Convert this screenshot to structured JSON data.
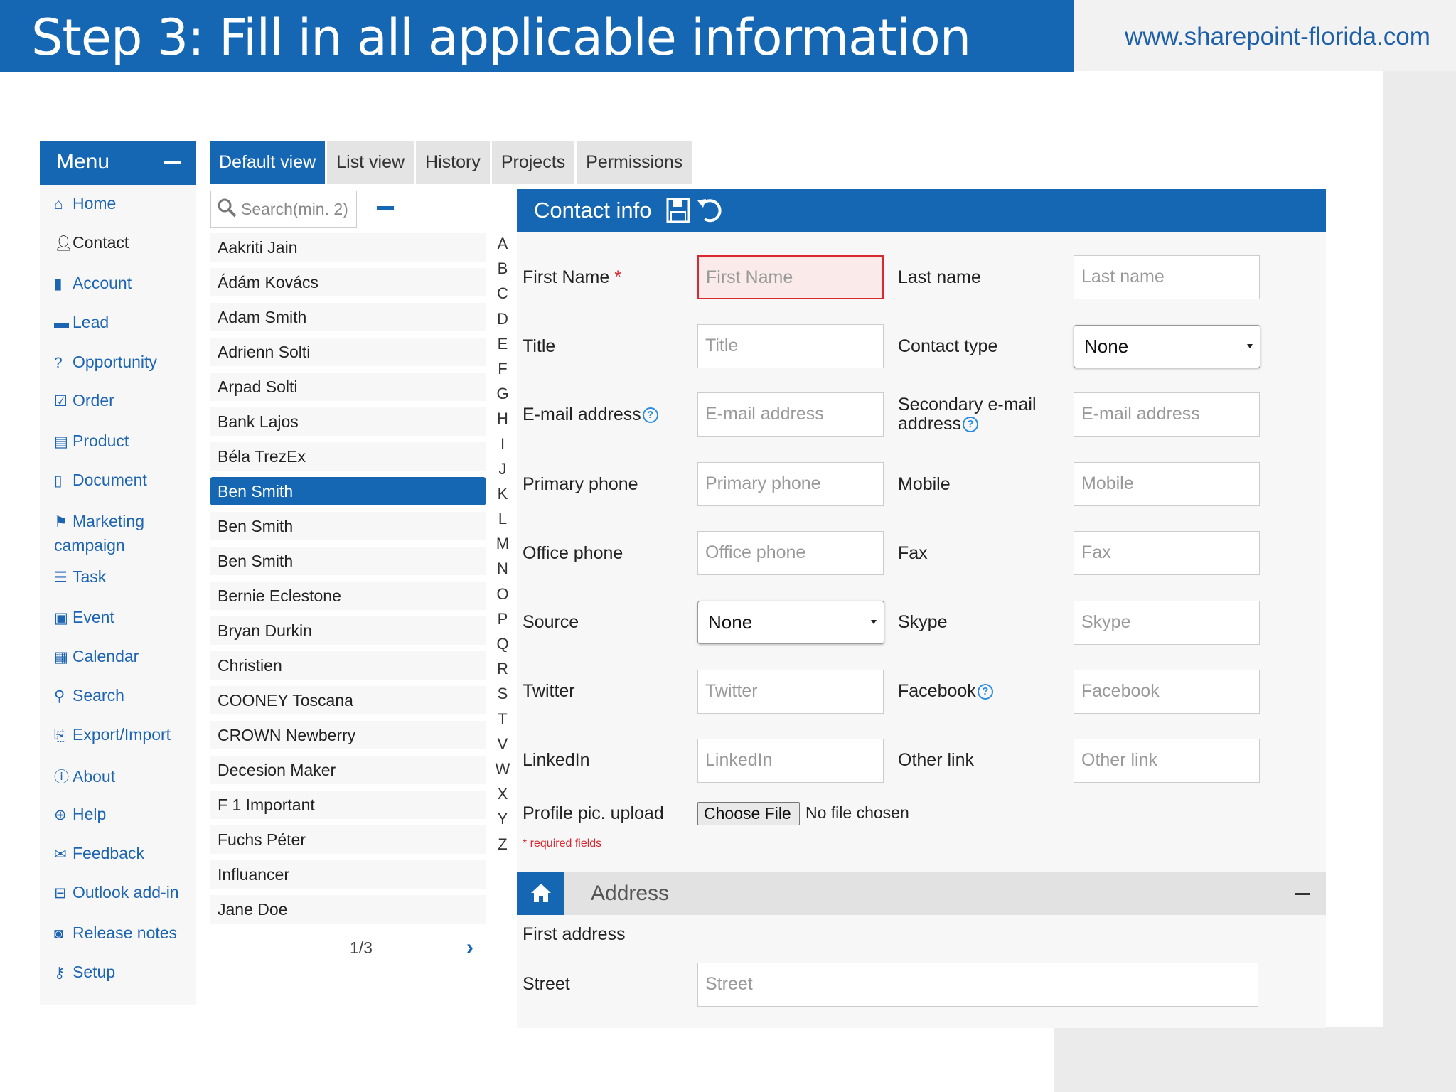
{
  "header": {
    "title": "Step 3: Fill in all applicable information",
    "site_url": "www.sharepoint-florida.com"
  },
  "menu": {
    "title": "Menu",
    "items": [
      {
        "label": "Home",
        "icon": "home-icon"
      },
      {
        "label": "Contact",
        "icon": "person-icon"
      },
      {
        "label": "Account",
        "icon": "bar-chart-icon"
      },
      {
        "label": "Lead",
        "icon": "briefcase-icon"
      },
      {
        "label": "Opportunity",
        "icon": "question-circle-icon"
      },
      {
        "label": "Order",
        "icon": "checklist-icon"
      },
      {
        "label": "Product",
        "icon": "cart-icon"
      },
      {
        "label": "Document",
        "icon": "file-icon"
      },
      {
        "label_line1": "Marketing",
        "label_line2": "campaign",
        "icon": "flag-icon"
      },
      {
        "label": "Task",
        "icon": "list-icon"
      },
      {
        "label": "Event",
        "icon": "calendar-check-icon"
      },
      {
        "label": "Calendar",
        "icon": "calendar-icon"
      },
      {
        "label": "Search",
        "icon": "search-icon"
      },
      {
        "label": "Export/Import",
        "icon": "export-icon"
      },
      {
        "label": "About",
        "icon": "info-icon"
      },
      {
        "label": "Help",
        "icon": "lifebuoy-icon"
      },
      {
        "label": "Feedback",
        "icon": "envelope-icon"
      },
      {
        "label": "Outlook add-in",
        "icon": "outlook-icon"
      },
      {
        "label": "Release notes",
        "icon": "rss-icon"
      },
      {
        "label": "Setup",
        "icon": "key-icon"
      }
    ]
  },
  "tabs": [
    "Default view",
    "List view",
    "History",
    "Projects",
    "Permissions"
  ],
  "active_tab": "Default view",
  "search": {
    "placeholder": "Search(min. 2)"
  },
  "contacts": [
    "Aakriti Jain",
    "Ádám Kovács",
    "Adam Smith",
    "Adrienn Solti",
    "Arpad Solti",
    "Bank Lajos",
    "Béla TrezEx",
    "Ben Smith",
    "Ben Smith",
    "Ben Smith",
    "Bernie Eclestone",
    "Bryan Durkin",
    "Christien",
    "COONEY Toscana",
    "CROWN Newberry",
    "Decesion Maker",
    "F 1 Important",
    "Fuchs Péter",
    "Influancer",
    "Jane Doe"
  ],
  "selected_contact_index": 7,
  "pager": {
    "text": "1/3",
    "next": "›"
  },
  "alphabet": [
    "A",
    "B",
    "C",
    "D",
    "E",
    "F",
    "G",
    "H",
    "I",
    "J",
    "K",
    "L",
    "M",
    "N",
    "O",
    "P",
    "Q",
    "R",
    "S",
    "T",
    "V",
    "W",
    "X",
    "Y",
    "Z"
  ],
  "panel": {
    "title": "Contact info",
    "fields": {
      "first_name": {
        "label": "First Name",
        "required_mark": "*",
        "placeholder": "First Name"
      },
      "last_name": {
        "label": "Last name",
        "placeholder": "Last name"
      },
      "title": {
        "label": "Title",
        "placeholder": "Title"
      },
      "contact_type": {
        "label": "Contact type",
        "value": "None"
      },
      "email": {
        "label": "E-mail address",
        "placeholder": "E-mail address"
      },
      "secondary_email": {
        "label_line1": "Secondary e-mail",
        "label_line2": "address",
        "placeholder": "E-mail address"
      },
      "primary_phone": {
        "label": "Primary phone",
        "placeholder": "Primary phone"
      },
      "mobile": {
        "label": "Mobile",
        "placeholder": "Mobile"
      },
      "office_phone": {
        "label": "Office phone",
        "placeholder": "Office phone"
      },
      "fax": {
        "label": "Fax",
        "placeholder": "Fax"
      },
      "source": {
        "label": "Source",
        "value": "None"
      },
      "skype": {
        "label": "Skype",
        "placeholder": "Skype"
      },
      "twitter": {
        "label": "Twitter",
        "placeholder": "Twitter"
      },
      "facebook": {
        "label": "Facebook",
        "placeholder": "Facebook"
      },
      "linkedin": {
        "label": "LinkedIn",
        "placeholder": "LinkedIn"
      },
      "other_link": {
        "label": "Other link",
        "placeholder": "Other link"
      },
      "profile_pic": {
        "label": "Profile pic. upload",
        "button": "Choose File",
        "status": "No file chosen"
      }
    },
    "required_note": "* required fields"
  },
  "address": {
    "title": "Address",
    "first_address_label": "First address",
    "street": {
      "label": "Street",
      "placeholder": "Street"
    }
  },
  "colors": {
    "primary": "#1567b3",
    "error": "#d9282f",
    "help": "#2a8be0"
  }
}
